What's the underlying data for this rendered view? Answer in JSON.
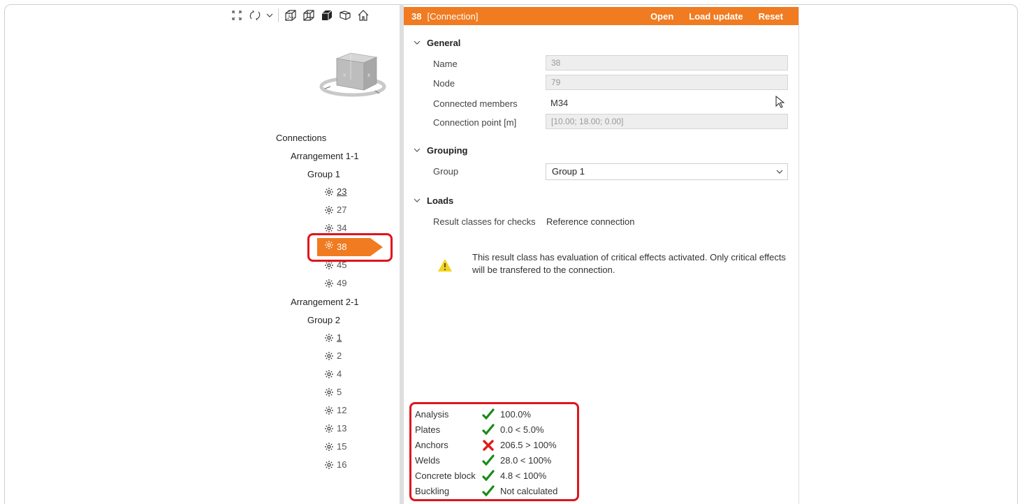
{
  "toolbar": {
    "icons": [
      "fit-view-icon",
      "rotate-icon",
      "dropdown-arrow-icon",
      "wireframe-view-icon",
      "transparent-view-icon",
      "solid-view-icon",
      "eye-view-icon",
      "home-icon"
    ]
  },
  "tree": {
    "root": "Connections",
    "arrangement1": "Arrangement 1-1",
    "group1": "Group 1",
    "group1_items": [
      "23",
      "27",
      "34",
      "38",
      "45",
      "49"
    ],
    "arrangement2": "Arrangement 2-1",
    "group2": "Group 2",
    "group2_items": [
      "1",
      "2",
      "4",
      "5",
      "12",
      "13",
      "15",
      "16"
    ],
    "selected": "38"
  },
  "panel": {
    "header": {
      "id": "38",
      "title": "[Connection]",
      "actions": [
        "Open",
        "Load update",
        "Reset"
      ]
    },
    "general": {
      "title": "General",
      "name_label": "Name",
      "name_value": "38",
      "node_label": "Node",
      "node_value": "79",
      "members_label": "Connected members",
      "members_value": "M34",
      "point_label": "Connection point [m]",
      "point_value": "[10.00; 18.00; 0.00]"
    },
    "grouping": {
      "title": "Grouping",
      "group_label": "Group",
      "group_value": "Group 1"
    },
    "loads": {
      "title": "Loads",
      "result_label": "Result classes for checks",
      "result_value": "Reference connection",
      "warning": "This result class has evaluation of critical effects activated. Only critical effects will be transfered to the connection."
    }
  },
  "results": [
    {
      "name": "Analysis",
      "status": "ok",
      "value": "100.0%"
    },
    {
      "name": "Plates",
      "status": "ok",
      "value": "0.0 < 5.0%"
    },
    {
      "name": "Anchors",
      "status": "fail",
      "value": "206.5 > 100%"
    },
    {
      "name": "Welds",
      "status": "ok",
      "value": "28.0 < 100%"
    },
    {
      "name": "Concrete block",
      "status": "ok",
      "value": "4.8 < 100%"
    },
    {
      "name": "Buckling",
      "status": "ok",
      "value": "Not calculated"
    }
  ],
  "colors": {
    "accent": "#f07b21",
    "highlight": "#e0141e",
    "ok": "#1a8a1a",
    "fail": "#e01b1b"
  }
}
